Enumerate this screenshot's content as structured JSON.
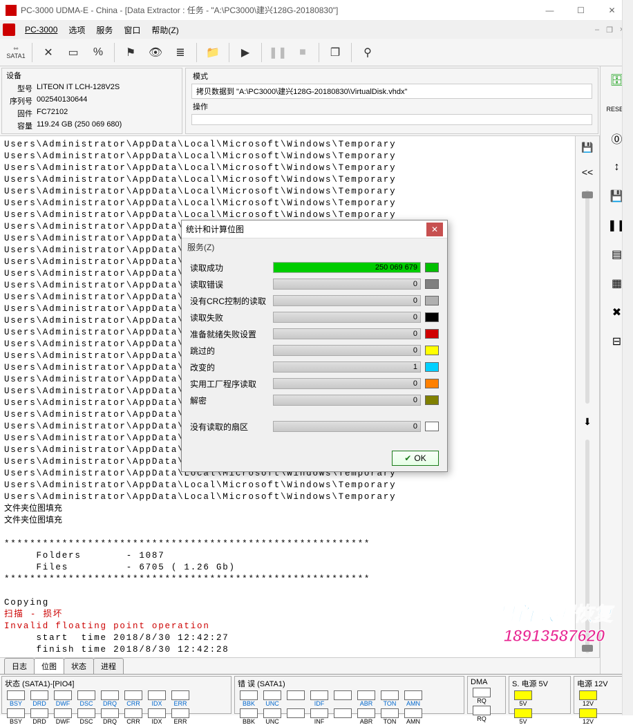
{
  "window": {
    "title": "PC-3000 UDMA-E - China - [Data Extractor : 任务 - \"A:\\PC3000\\建兴128G-20180830\"]"
  },
  "menu": {
    "app": "PC-3000",
    "items": [
      "选项",
      "服务",
      "窗口",
      "帮助(Z)"
    ]
  },
  "toolbar_sata": "SATA1",
  "device": {
    "header": "设备",
    "model_lbl": "型号",
    "model": "LITEON IT LCH-128V2S",
    "serial_lbl": "序列号",
    "serial": "002540130644",
    "fw_lbl": "固件",
    "fw": "FC72102",
    "cap_lbl": "容量",
    "cap": "119.24 GB (250 069 680)"
  },
  "mode": {
    "header": "模式",
    "value": "拷贝数据到 \"A:\\PC3000\\建兴128G-20180830\\VirtualDisk.vhdx\"",
    "op_header": "操作"
  },
  "log_path": "Users\\Administrator\\AppData\\Local\\Microsoft\\Windows\\Temporary",
  "folder_fill": "文件夹位图填充",
  "stars": "*********************************************************",
  "summary": {
    "folders_lbl": "Folders",
    "folders_val": "- 1087",
    "files_lbl": "Files",
    "files_val": "- 6705 ( 1.26 Gb)"
  },
  "copying": "Copying",
  "scan": "扫描 - 损坏",
  "error": "Invalid floating point operation",
  "times": {
    "start": "     start  time 2018/8/30 12:42:27",
    "finish": "     finish time 2018/8/30 12:42:28"
  },
  "tabs": {
    "t0": "日志",
    "t1": "位图",
    "t2": "状态",
    "t3": "进程"
  },
  "dialog": {
    "title": "统计和计算位图",
    "menu": "服务(Z)",
    "rows": [
      {
        "label": "读取成功",
        "value": "250 069 679",
        "color": "#00c000"
      },
      {
        "label": "读取错误",
        "value": "0",
        "color": "#808080"
      },
      {
        "label": "没有CRC控制的读取",
        "value": "0",
        "color": "#b0b0b0"
      },
      {
        "label": "读取失败",
        "value": "0",
        "color": "#000000"
      },
      {
        "label": "准备就绪失败设置",
        "value": "0",
        "color": "#d00000"
      },
      {
        "label": "跳过的",
        "value": "0",
        "color": "#ffff00"
      },
      {
        "label": "改变的",
        "value": "1",
        "color": "#00d0ff"
      },
      {
        "label": "实用工厂程序读取",
        "value": "0",
        "color": "#ff8000"
      },
      {
        "label": "解密",
        "value": "0",
        "color": "#808000"
      }
    ],
    "unread": {
      "label": "没有读取的扇区",
      "value": "0",
      "color": "#ffffff"
    },
    "ok": "OK"
  },
  "status": {
    "sata_hdr": "状态 (SATA1)-[PIO4]",
    "sata_leds": [
      "BSY",
      "DRD",
      "DWF",
      "DSC",
      "DRQ",
      "CRR",
      "IDX",
      "ERR"
    ],
    "err_hdr": "错 误 (SATA1)",
    "err_leds": [
      "BBK",
      "UNC",
      "",
      "IDF",
      "",
      "ABR",
      "TON",
      "AMN"
    ],
    "dma_hdr": "DMA",
    "dma_led": "RQ",
    "pwr5_hdr": "S. 电源 5V",
    "pwr5_led": "5V",
    "pwr12_hdr": "电源 12V",
    "pwr12_led": "12V",
    "bottom_leds1": [
      "BSY",
      "DRD",
      "DWF",
      "DSC",
      "DRQ",
      "CRR",
      "IDX",
      "ERR"
    ],
    "bottom_leds2": [
      "BBK",
      "UNC",
      "",
      "INF",
      "",
      "ABR",
      "TON",
      "AMN"
    ],
    "bottom_rq": "RQ",
    "bottom_5v": "5V",
    "bottom_12v": "12V"
  },
  "watermark": {
    "l1": "盘首数据恢复",
    "l2": "18913587620"
  }
}
